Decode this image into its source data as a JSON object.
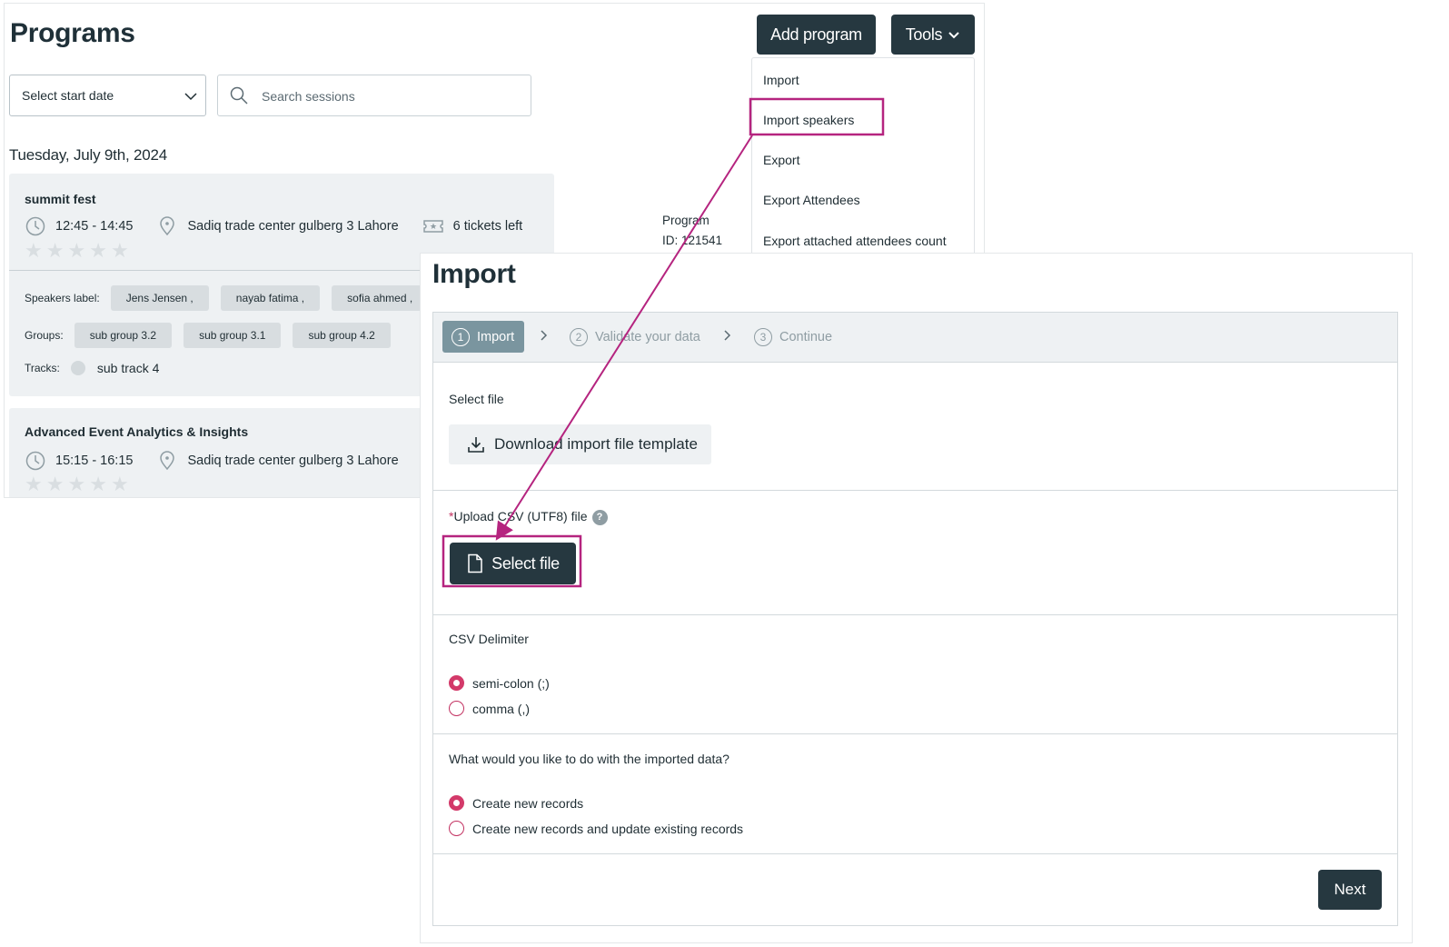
{
  "programs": {
    "title": "Programs",
    "add_program_label": "Add program",
    "tools_label": "Tools",
    "date_select": "Select start date",
    "search_placeholder": "Search sessions",
    "day_header": "Tuesday, July 9th, 2024",
    "sessions": [
      {
        "title": "summit fest",
        "time": "12:45 - 14:45",
        "location": "Sadiq trade center gulberg 3 Lahore",
        "tickets": "6 tickets left",
        "program_line1": "Program",
        "program_line2": "ID: 121541",
        "speakers_label": "Speakers label:",
        "speakers": [
          "Jens Jensen ,",
          "nayab fatima ,",
          "sofia ahmed ,"
        ],
        "groups_label": "Groups:",
        "groups": [
          "sub group 3.2",
          "sub group 3.1",
          "sub group 4.2"
        ],
        "tracks_label": "Tracks:",
        "track": "sub track 4"
      },
      {
        "title": "Advanced Event Analytics & Insights",
        "time": "15:15 - 16:15",
        "location": "Sadiq trade center gulberg 3 Lahore"
      }
    ]
  },
  "tools_menu": {
    "items": [
      "Import",
      "Import speakers",
      "Export",
      "Export Attendees",
      "Export attached attendees count"
    ],
    "highlighted": "Import speakers"
  },
  "import": {
    "title": "Import",
    "steps": [
      {
        "num": "1",
        "label": "Import"
      },
      {
        "num": "2",
        "label": "Validate your data"
      },
      {
        "num": "3",
        "label": "Continue"
      }
    ],
    "select_file_label": "Select file",
    "download_label": "Download import file template",
    "upload_required_mark": "*",
    "upload_label": "Upload CSV (UTF8) file",
    "help_glyph": "?",
    "select_file_button": "Select file",
    "delimiter_label": "CSV Delimiter",
    "delimiter_options": [
      "semi-colon (;)",
      "comma (,)"
    ],
    "data_question": "What would you like to do with the imported data?",
    "data_options": [
      "Create new records",
      "Create new records and update existing records"
    ],
    "next_label": "Next"
  },
  "colors": {
    "dark_button": "#263840",
    "highlight": "#b5247f",
    "radio_accent": "#d33a6a",
    "active_step": "#7a959f"
  }
}
